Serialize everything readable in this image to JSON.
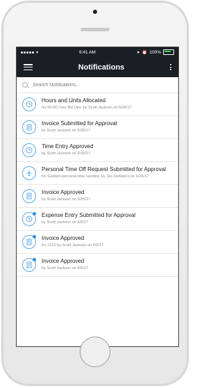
{
  "status_bar": {
    "carrier": "•••••",
    "time": "9:41 AM",
    "battery": "100%"
  },
  "nav": {
    "title": "Notifications"
  },
  "search": {
    "placeholder": "Search Notifications..."
  },
  "items": [
    {
      "icon": "clock-icon",
      "unread": false,
      "title": "Hours and Units Allocated",
      "subtitle": "for 00-00 Core Biz Dev. by Scott Jackson on 6/28/17"
    },
    {
      "icon": "document-icon",
      "unread": false,
      "title": "Invoice Submitted for Approval",
      "subtitle": "by Scott Jackson on 6/26/17"
    },
    {
      "icon": "clock-icon",
      "unread": false,
      "title": "Time  Entry Approved",
      "subtitle": "by Scott Jackson on 6/26/17"
    },
    {
      "icon": "airplane-icon",
      "unread": false,
      "title": "Personal Time Off Request Submitted for Approval",
      "subtitle": "for Sudden personal time needed. by Jan DeMarco on 6/26/17"
    },
    {
      "icon": "document-icon",
      "unread": false,
      "title": "Invoice Approved",
      "subtitle": "by Scott Jackson on 6/25/17"
    },
    {
      "icon": "dollar-icon",
      "unread": true,
      "title": "Expense Entry Submitted for Approval",
      "subtitle": "by Scott Jackson on 6/6/17"
    },
    {
      "icon": "document-icon",
      "unread": true,
      "title": "Invoice Approved",
      "subtitle": "for 1210 by Scott Jackson on 6/5/17"
    },
    {
      "icon": "document-icon",
      "unread": true,
      "title": "Invoice Approved",
      "subtitle": "by Scott Jackson on 6/5/17"
    }
  ],
  "colors": {
    "nav_bg": "#1a1f24",
    "accent": "#2b8fe0",
    "icon_border": "#5aa8e6"
  }
}
